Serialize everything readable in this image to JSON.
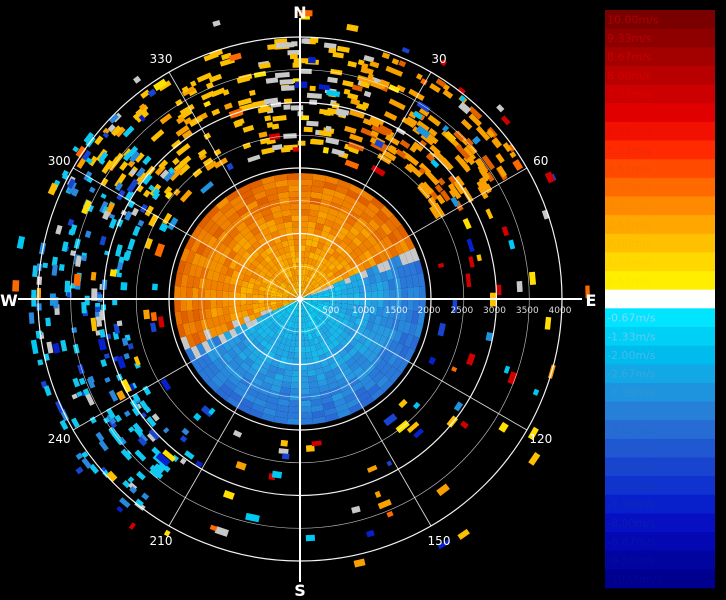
{
  "chart_data": {
    "type": "heatmap",
    "projection": "polar (radar PPI, north-up)",
    "cardinal_labels": {
      "north": "N",
      "east": "E",
      "south": "S",
      "west": "W"
    },
    "azimuth_labels": [
      "30",
      "60",
      "120",
      "150",
      "210",
      "240",
      "300",
      "330"
    ],
    "azimuth_label_angles_deg": [
      30,
      60,
      120,
      150,
      210,
      240,
      300,
      330
    ],
    "range_labels": [
      "500",
      "1000",
      "1500",
      "2000",
      "2500",
      "3000",
      "3500",
      "4000"
    ],
    "range_values": [
      500,
      1000,
      1500,
      2000,
      2500,
      3000,
      3500,
      4000
    ],
    "range_max": 4000,
    "grid": true,
    "legend_placement": "right",
    "colorbar": {
      "labels": [
        "10.00m/s",
        "9.33m/s",
        "8.67m/s",
        "8.00m/s",
        "7.33m/s",
        "6.67m/s",
        "6.00m/s",
        "5.33m/s",
        "4.67m/s",
        "4.00m/s",
        "3.33m/s",
        "2.67m/s",
        "2.00m/s",
        "1.33m/s",
        "0.67m/s",
        "0.00m/s",
        "-0.67m/s",
        "-1.33m/s",
        "-2.00m/s",
        "-2.67m/s",
        "-3.33m/s",
        "-4.00m/s",
        "-4.67m/s",
        "-5.33m/s",
        "-6.00m/s",
        "-6.67m/s",
        "-7.33m/s",
        "-8.00m/s",
        "-8.67m/s",
        "-9.33m/s",
        "-10.00m/s"
      ],
      "values": [
        10,
        9.33,
        8.67,
        8,
        7.33,
        6.67,
        6,
        5.33,
        4.67,
        4,
        3.33,
        2.67,
        2,
        1.33,
        0.67,
        0,
        -0.67,
        -1.33,
        -2,
        -2.67,
        -3.33,
        -4,
        -4.67,
        -5.33,
        -6,
        -6.67,
        -7.33,
        -8,
        -8.67,
        -9.33,
        -10
      ],
      "colors": [
        "#7a0000",
        "#8e0000",
        "#a30000",
        "#b80000",
        "#cc0000",
        "#e00000",
        "#f21000",
        "#ff2a00",
        "#ff4a00",
        "#ff6a00",
        "#ff8a00",
        "#ffa600",
        "#ffc000",
        "#ffd800",
        "#ffee00",
        "#ffffff",
        "#00e4ff",
        "#00d0f6",
        "#00bcee",
        "#12a8e6",
        "#1e94de",
        "#2680d8",
        "#266cd4",
        "#2058d2",
        "#1844d0",
        "#1032ce",
        "#0820cc",
        "#0610c2",
        "#0408b2",
        "#0204a0",
        "#00008e"
      ],
      "label_colors": [
        "#b00000",
        "#bc0000",
        "#c80000",
        "#d40000",
        "#dc0000",
        "#e40000",
        "#ec1000",
        "#f02a00",
        "#f24a00",
        "#f46a00",
        "#f68a00",
        "#f8a400",
        "#fabc00",
        "#fcd400",
        "#fee800",
        "#ffffff",
        "#7fd8ff",
        "#60c8f0",
        "#48b8e8",
        "#3aa6e0",
        "#3094d8",
        "#2a80d2",
        "#246ccc",
        "#1e58c6",
        "#1848c0",
        "#1238ba",
        "#0c2ab4",
        "#081eae",
        "#0414a8",
        "#020ca2",
        "#00069c"
      ]
    },
    "regions": [
      {
        "description": "approaching half (positive velocities), north-west side",
        "color_range": [
          "#e06000",
          "#ffd800"
        ]
      },
      {
        "description": "receding half (negative velocities), south-east side",
        "color_range": [
          "#00c8f0",
          "#2a70d8"
        ]
      }
    ]
  }
}
